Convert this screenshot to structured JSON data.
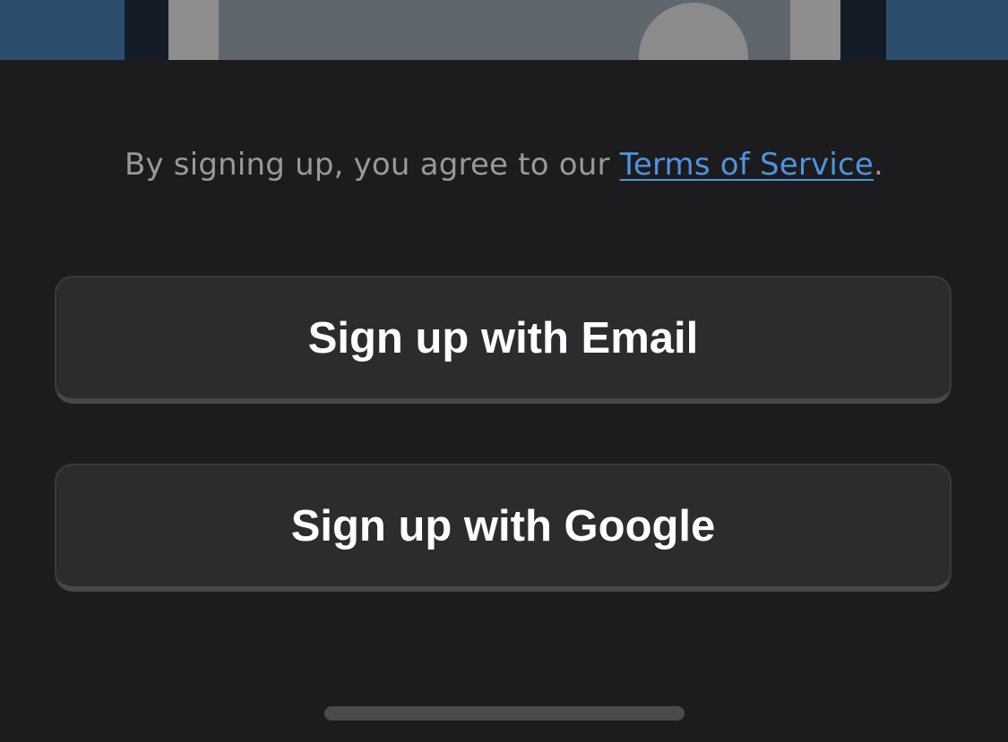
{
  "terms": {
    "prefix": "By signing up, you agree to our ",
    "link_label": "Terms of Service",
    "suffix": "."
  },
  "buttons": {
    "email_label": "Sign up with Email",
    "google_label": "Sign up with Google"
  },
  "colors": {
    "background": "#1c1c1e",
    "button_bg": "#2c2c2e",
    "link": "#4f93de",
    "muted_text": "#98989d",
    "hero_blue": "#2b4e6f"
  }
}
